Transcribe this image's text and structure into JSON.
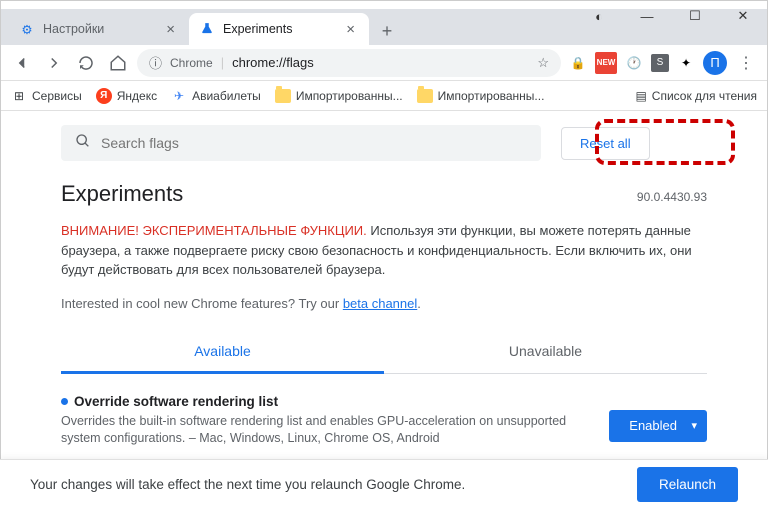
{
  "window": {
    "tabs": [
      {
        "title": "Настройки"
      },
      {
        "title": "Experiments"
      }
    ]
  },
  "omnibox": {
    "secure_label": "Chrome",
    "url": "chrome://flags"
  },
  "bookmarks": {
    "items": [
      "Сервисы",
      "Яндекс",
      "Авиабилеты",
      "Импортированны...",
      "Импортированны..."
    ],
    "reading_list": "Список для чтения"
  },
  "flags": {
    "search_placeholder": "Search flags",
    "reset_label": "Reset all",
    "title": "Experiments",
    "version": "90.0.4430.93",
    "warning_red": "ВНИМАНИЕ! ЭКСПЕРИМЕНТАЛЬНЫЕ ФУНКЦИИ.",
    "warning_text": " Используя эти функции, вы можете потерять данные браузера, а также подвергаете риску свою безопасность и конфиденциальность. Если включить их, они будут действовать для всех пользователей браузера.",
    "interested_prefix": "Interested in cool new Chrome features? Try our ",
    "interested_link": "beta channel",
    "interested_suffix": ".",
    "tab_available": "Available",
    "tab_unavailable": "Unavailable",
    "entries": [
      {
        "name": "Override software rendering list",
        "description": "Overrides the built-in software rendering list and enables GPU-acceleration on unsupported system configurations. – Mac, Windows, Linux, Chrome OS, Android",
        "state": "Enabled"
      }
    ]
  },
  "footer": {
    "message": "Your changes will take effect the next time you relaunch Google Chrome.",
    "relaunch": "Relaunch"
  }
}
